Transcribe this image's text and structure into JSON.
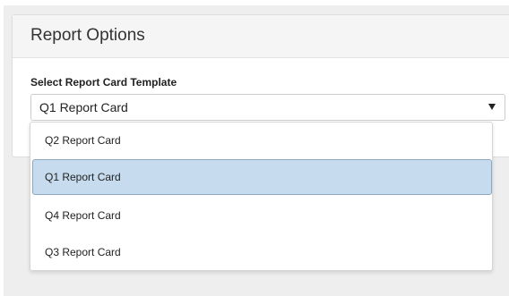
{
  "panel": {
    "title": "Report Options"
  },
  "template_select": {
    "label": "Select Report Card Template",
    "value": "Q1 Report Card",
    "options": [
      {
        "label": "Q2 Report Card",
        "selected": false
      },
      {
        "label": "Q1 Report Card",
        "selected": true
      },
      {
        "label": "Q4 Report Card",
        "selected": false
      },
      {
        "label": "Q3 Report Card",
        "selected": false
      }
    ]
  },
  "colors": {
    "selected_bg": "#c6dcee",
    "selected_border": "#8ea7bb",
    "panel_header_bg": "#f5f5f5",
    "page_bg": "#eeeeee"
  }
}
